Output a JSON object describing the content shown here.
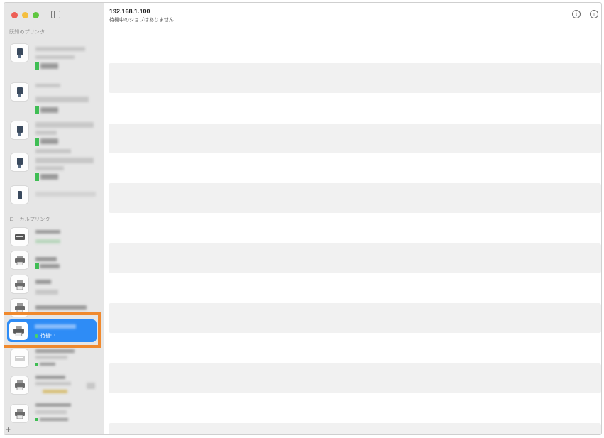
{
  "window": {
    "title": "192.168.1.100"
  },
  "header": {
    "printer_address": "192.168.1.100",
    "status": "待機中のジョブはありません",
    "info_icon": "info-icon",
    "pause_icon": "pause-icon"
  },
  "sidebar": {
    "toggle_icon": "sidebar-icon",
    "known_section": "既知のプリンタ",
    "local_section": "ローカルプリンタ",
    "add_label": "+",
    "selected": {
      "status": "待機中"
    }
  },
  "colors": {
    "accent": "#2e8cf6",
    "highlight": "#f0892d",
    "online": "#3fbe54"
  }
}
